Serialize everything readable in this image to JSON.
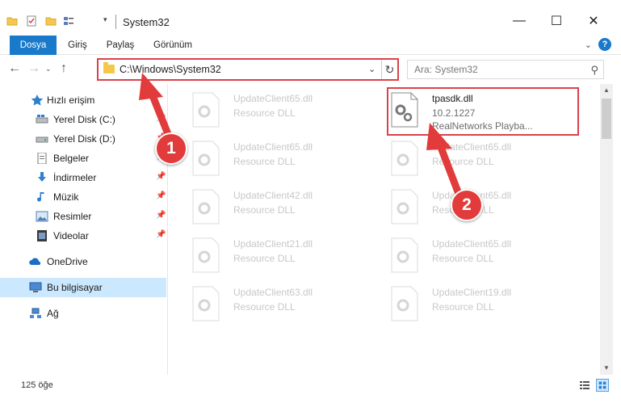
{
  "window": {
    "title": "System32",
    "minimize_glyph": "—",
    "maximize_glyph": "☐",
    "close_glyph": "✕"
  },
  "ribbon": {
    "tabs": [
      "Dosya",
      "Giriş",
      "Paylaş",
      "Görünüm"
    ],
    "active_tab": "Dosya",
    "accent": "#1979ca"
  },
  "address": {
    "path": "C:\\Windows\\System32",
    "search_placeholder": "Ara: System32"
  },
  "sidebar": {
    "items": [
      {
        "label": "Hızlı erişim",
        "icon": "star-icon",
        "pinned": false
      },
      {
        "label": "Yerel Disk (C:)",
        "icon": "drive-c-icon",
        "pinned": true
      },
      {
        "label": "Yerel Disk (D:)",
        "icon": "drive-d-icon",
        "pinned": true
      },
      {
        "label": "Belgeler",
        "icon": "documents-icon",
        "pinned": true
      },
      {
        "label": "İndirmeler",
        "icon": "downloads-icon",
        "pinned": true
      },
      {
        "label": "Müzik",
        "icon": "music-icon",
        "pinned": true
      },
      {
        "label": "Resimler",
        "icon": "pictures-icon",
        "pinned": true
      },
      {
        "label": "Videolar",
        "icon": "videos-icon",
        "pinned": true
      },
      {
        "label": "OneDrive",
        "icon": "onedrive-icon",
        "pinned": false
      },
      {
        "label": "Bu bilgisayar",
        "icon": "computer-icon",
        "pinned": false
      },
      {
        "label": "Ağ",
        "icon": "network-icon",
        "pinned": false
      }
    ],
    "selected": "Bu bilgisayar"
  },
  "files": {
    "highlighted": {
      "name": "tpasdk.dll",
      "version": "10.2.1227",
      "description": "RealNetworks Playba..."
    },
    "faded": [
      {
        "name": "UpdateClient65.dll",
        "desc": "Resource DLL"
      },
      {
        "name": "UpdateClient65.dll",
        "desc": "Resource DLL"
      },
      {
        "name": "UpdateClient65.dll",
        "desc": "Resource DLL"
      },
      {
        "name": "UpdateClient42.dll",
        "desc": "Resource DLL"
      },
      {
        "name": "UpdateClient65.dll",
        "desc": "Resource DLL"
      },
      {
        "name": "UpdateClient21.dll",
        "desc": "Resource DLL"
      },
      {
        "name": "UpdateClient65.dll",
        "desc": "Resource DLL"
      },
      {
        "name": "UpdateClient63.dll",
        "desc": "Resource DLL"
      },
      {
        "name": "UpdateClient19.dll",
        "desc": "Resource DLL"
      }
    ]
  },
  "status": {
    "item_count": "125 öğe"
  },
  "annotations": {
    "badge1": "1",
    "badge2": "2",
    "color": "#e23b3b"
  }
}
